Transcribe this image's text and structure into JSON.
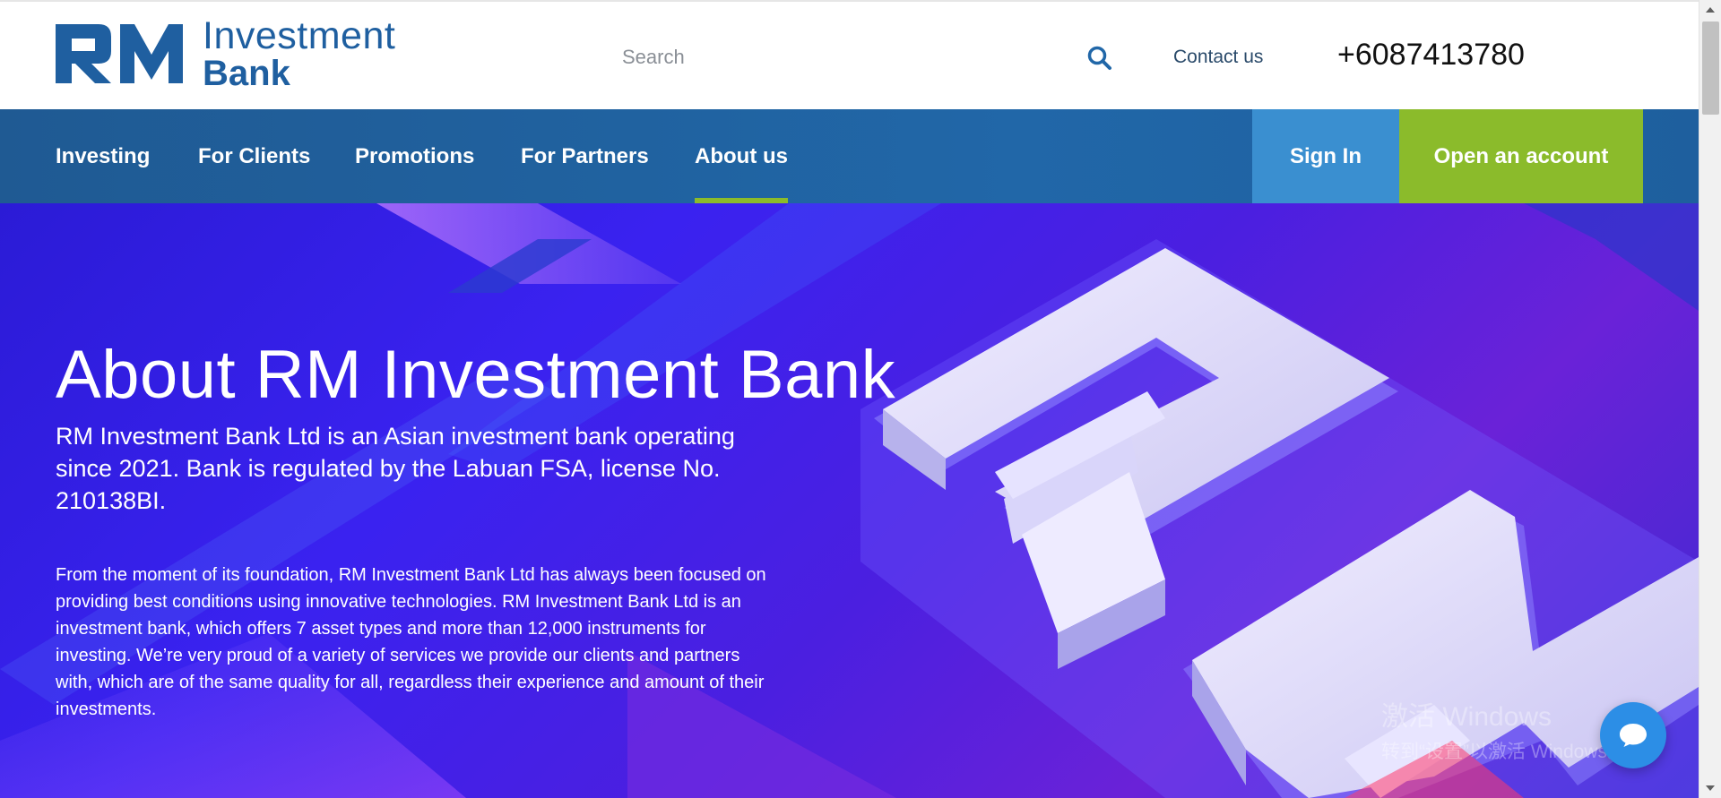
{
  "header": {
    "logo_line1": "Investment",
    "logo_line2": "Bank",
    "logo_mark": "RM",
    "search_placeholder": "Search",
    "search_icon": "search-icon",
    "contact_label": "Contact us",
    "phone": "+6087413780"
  },
  "nav": {
    "items": [
      {
        "label": "Investing"
      },
      {
        "label": "For Clients"
      },
      {
        "label": "Promotions"
      },
      {
        "label": "For Partners"
      },
      {
        "label": "About us"
      }
    ],
    "active": "About us",
    "signin_label": "Sign In",
    "open_account_label": "Open an account"
  },
  "hero": {
    "title": "About RM Investment Bank",
    "lead": "RM Investment Bank Ltd is an Asian investment bank operating since 2021. Bank is regulated by the Labuan FSA, license No. 210138BI.",
    "body": "From the moment of its foundation, RM Investment Bank Ltd has always been focused on providing best conditions using innovative technologies. RM Investment Bank Ltd is an investment bank, which offers 7 asset types and more than 12,000 instruments for investing. We’re very proud of a variety of services we provide our clients and partners with, which are of the same quality for all, regardless their experience and amount of their investments."
  },
  "watermark": {
    "line1": "激活 Windows",
    "line2": "转到“设置”以激活 Windows。"
  },
  "chat": {
    "icon": "chat-bubble-icon"
  },
  "colors": {
    "brand_blue": "#1f5fa0",
    "nav_blue": "#2167a8",
    "signin_blue": "#3a8fd0",
    "accent_green": "#8bbb2b",
    "hero_purple": "#3a22f0"
  }
}
